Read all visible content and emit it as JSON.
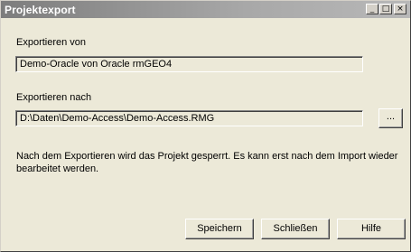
{
  "window": {
    "title": "Projektexport",
    "controls": {
      "minimize": "_",
      "maximize": "□",
      "close": "×"
    }
  },
  "source": {
    "label": "Exportieren von",
    "value": "Demo-Oracle von Oracle rmGEO4"
  },
  "target": {
    "label": "Exportieren nach",
    "value": "D:\\Daten\\Demo-Access\\Demo-Access.RMG",
    "browse_label": "..."
  },
  "message": "Nach dem Exportieren wird das Projekt gesperrt. Es kann erst nach dem Import wieder bearbeitet werden.",
  "buttons": {
    "save": "Speichern",
    "close": "Schließen",
    "help": "Hilfe"
  }
}
